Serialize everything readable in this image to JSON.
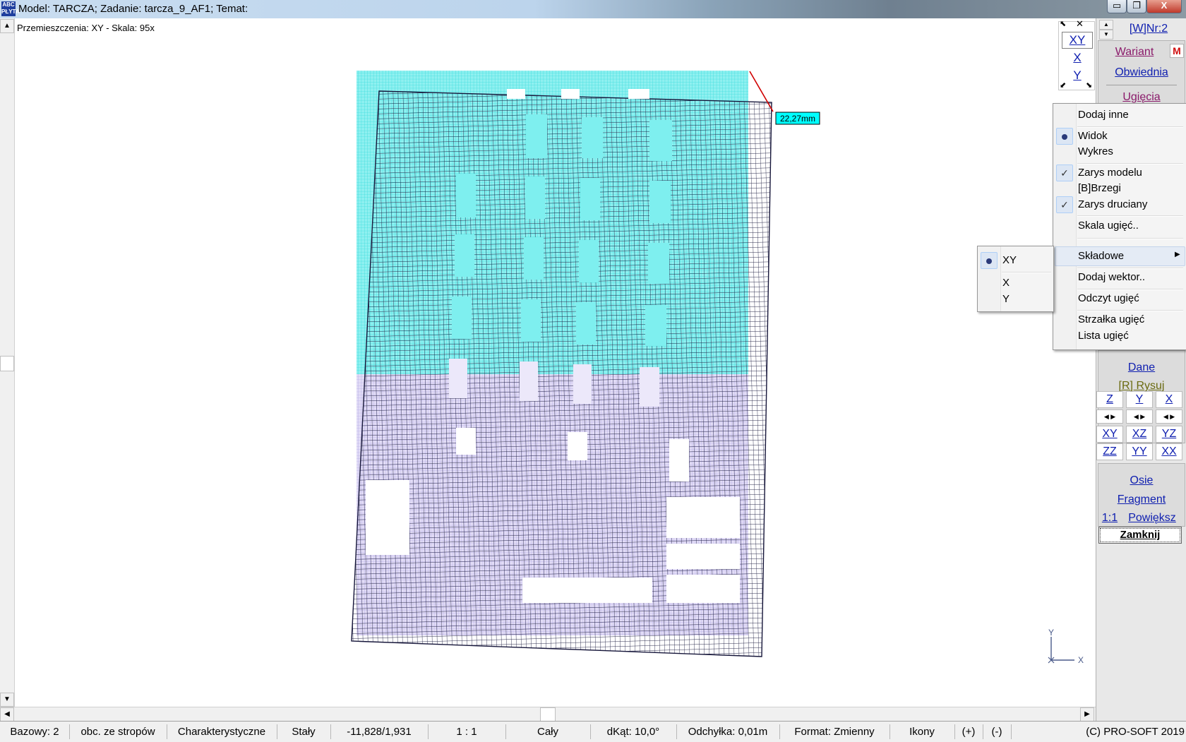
{
  "window": {
    "app_icon_text": "ABC PŁYTA",
    "title": "Model: TARCZA;  Zadanie: tarcza_9_AF1;  Temat:",
    "minimize_glyph": "▭",
    "maximize_glyph": "❐",
    "close_glyph": "X"
  },
  "view": {
    "title": "Przemieszczenia: XY  -  Skala: 95x",
    "max_displacement_label": "22,27mm",
    "axis_y_label": "Y",
    "axis_x_label": "X"
  },
  "component_selector": {
    "items": [
      "XY",
      "X",
      "Y"
    ],
    "selected": "XY"
  },
  "right_panel": {
    "variant_number": "[W]Nr:2",
    "wariant": "Wariant",
    "wariant_badge": "M",
    "obwiednia": "Obwiednia",
    "ugiecia": "Ugięcia",
    "dane": "Dane",
    "rysuj": "[R] Rysuj",
    "view_row1": [
      "Z",
      "Y",
      "X"
    ],
    "view_row2": [
      "XY",
      "XZ",
      "YZ"
    ],
    "view_row3": [
      "ZZ",
      "YY",
      "XX"
    ],
    "osie": "Osie",
    "fragment": "Fragment",
    "scale_one": "1:1",
    "powieksz": "Powiększ",
    "zamknij": "Zamknij"
  },
  "context_menu": {
    "dodaj_inne": "Dodaj inne",
    "widok": "Widok",
    "wykres": "Wykres",
    "zarys_modelu": "Zarys modelu",
    "brzegi": "[B]Brzegi",
    "zarys_druciany": "Zarys druciany",
    "skala_ugiec": "Skala ugięć..",
    "skladowe": "Składowe",
    "dodaj_wektor": "Dodaj wektor..",
    "odczyt_ugiec": "Odczyt ugięć",
    "strzalka_ugiec": "Strzałka ugięć",
    "lista_ugiec": "Lista ugięć",
    "check_glyph": "✓"
  },
  "submenu": {
    "items": [
      "XY",
      "X",
      "Y"
    ],
    "selected": "XY"
  },
  "status_bar": {
    "bazowy": "Bazowy: 2",
    "obciazenie": "obc. ze stropów",
    "typ": "Charakterystyczne",
    "stan": "Stały",
    "coords": "-11,828/1,931",
    "scale": "1 : 1",
    "zakres": "Cały",
    "dkat": "dKąt: 10,0°",
    "odchylka": "Odchyłka: 0,01m",
    "format": "Format: Zmienny",
    "ikony": "Ikony",
    "plus": "(+)",
    "minus": "(-)",
    "copyright": "(C) PRO-SOFT 2019"
  },
  "colors": {
    "undeformed_upper": "#4fe6e6",
    "undeformed_lower": "#c8c0ea",
    "deformed_mesh": "#16163a",
    "link_blue": "#1020b0",
    "label_bg": "#00ffff"
  }
}
